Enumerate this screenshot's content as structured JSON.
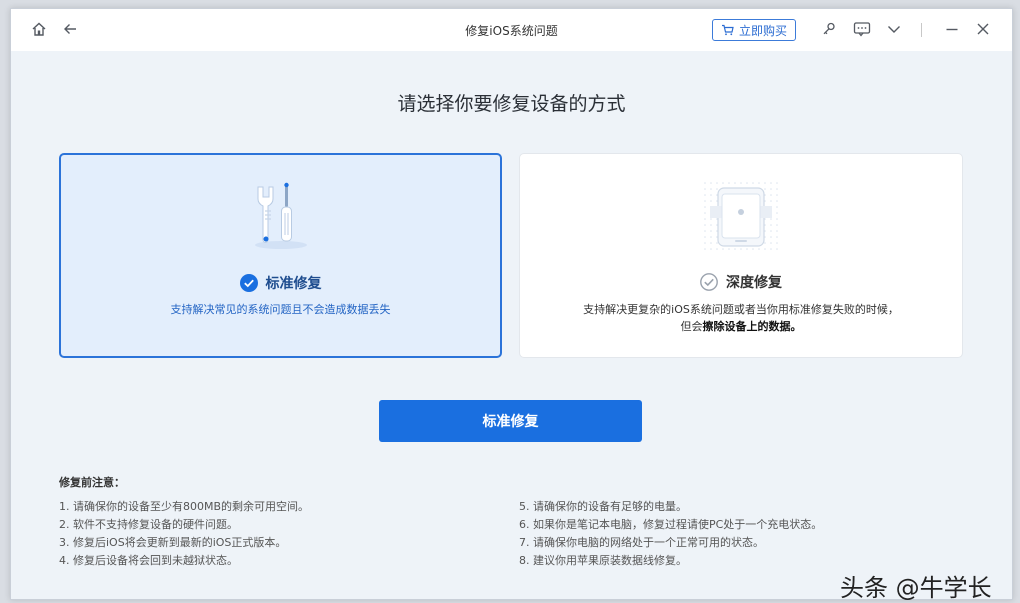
{
  "window": {
    "title": "修复iOS系统问题",
    "buy_button": "立即购买"
  },
  "icons": {
    "home": "home-icon",
    "back": "arrow-left-icon",
    "cart": "cart-icon",
    "key": "key-icon",
    "feedback": "feedback-icon",
    "dropdown": "chevron-down-icon",
    "minimize": "minimize-icon",
    "close": "close-icon"
  },
  "main": {
    "heading": "请选择你要修复设备的方式",
    "cards": [
      {
        "title": "标准修复",
        "description": "支持解决常见的系统问题且不会造成数据丢失",
        "selected": true
      },
      {
        "title": "深度修复",
        "description_part1": "支持解决更复杂的iOS系统问题或者当你用标准修复失败的时候，但会",
        "description_bold": "擦除设备上的数据。",
        "selected": false
      }
    ],
    "primary_button": "标准修复"
  },
  "notes": {
    "title": "修复前注意：",
    "left": [
      "1.  请确保你的设备至少有800MB的剩余可用空间。",
      "2.  软件不支持修复设备的硬件问题。",
      "3.  修复后iOS将会更新到最新的iOS正式版本。",
      "4.  修复后设备将会回到未越狱状态。"
    ],
    "right": [
      "5.  请确保你的设备有足够的电量。",
      "6.  如果你是笔记本电脑，修复过程请使PC处于一个充电状态。",
      "7.  请确保你电脑的网络处于一个正常可用的状态。",
      "8.  建议你用苹果原装数据线修复。"
    ]
  },
  "watermark": "头条 @牛学长",
  "colors": {
    "accent": "#1a6fe0",
    "selected_card_bg": "#e3eefc",
    "page_bg": "#eef3f8"
  }
}
